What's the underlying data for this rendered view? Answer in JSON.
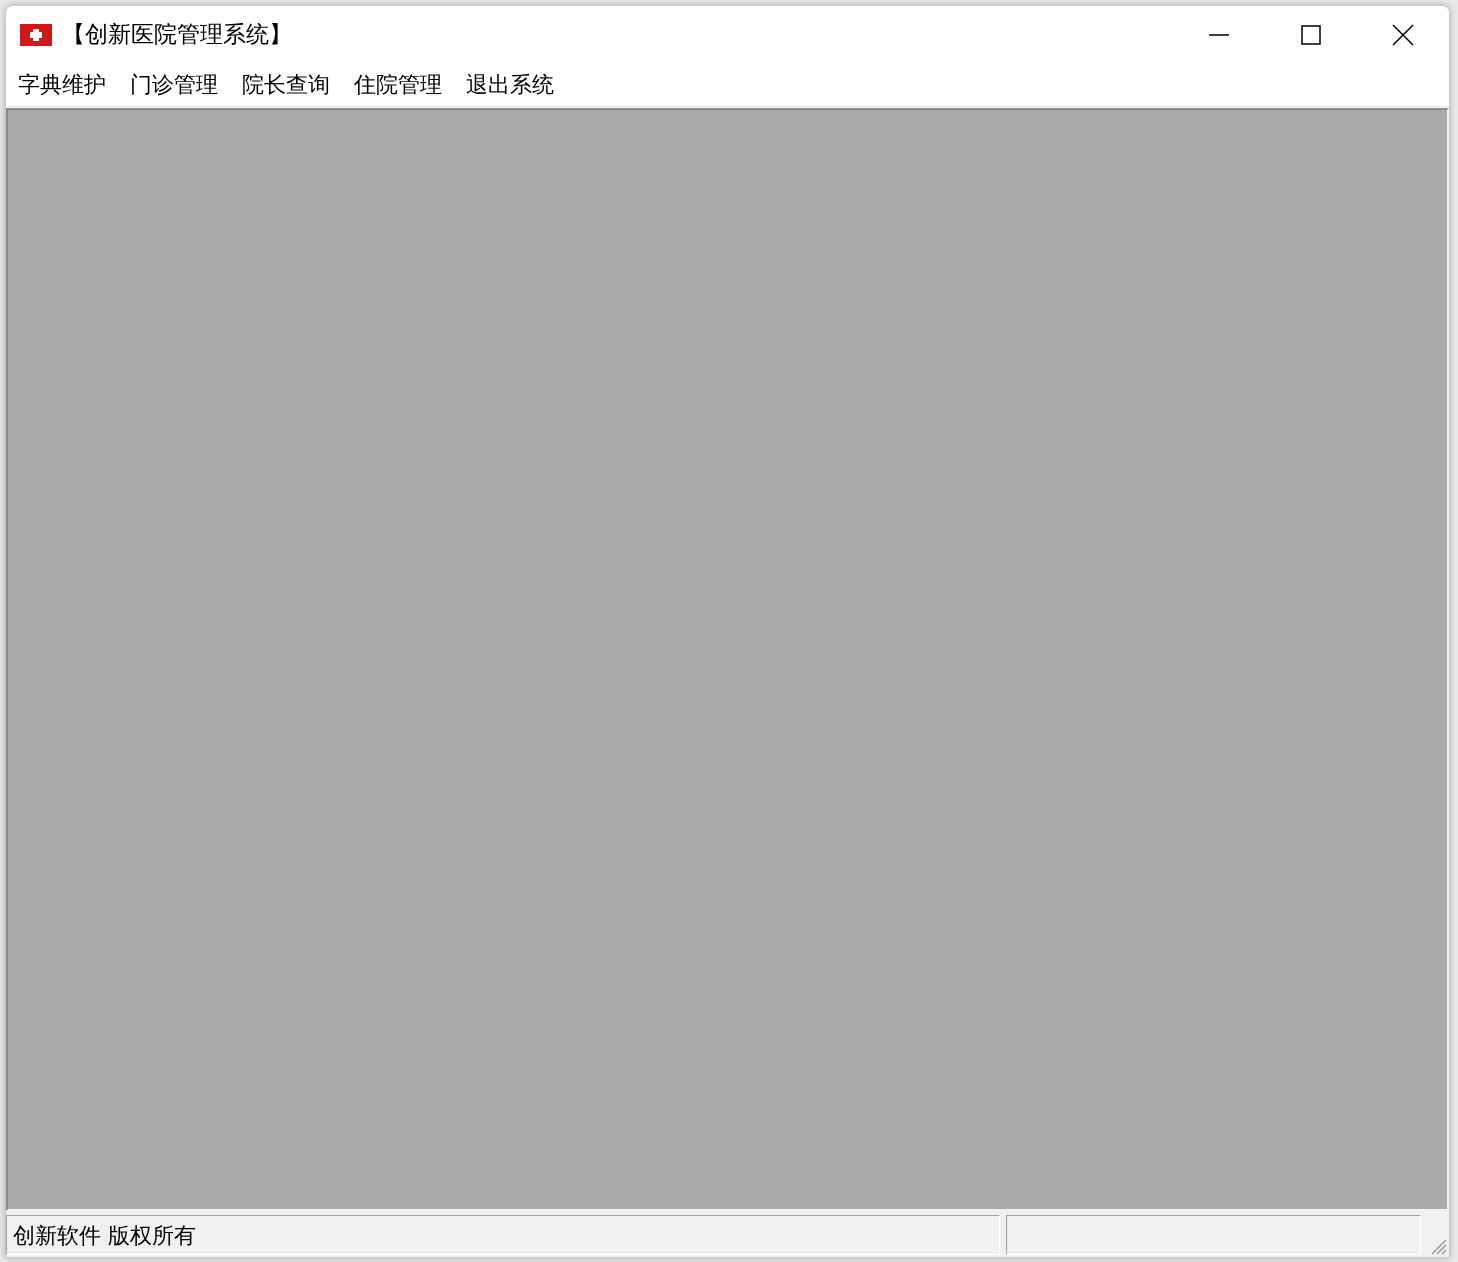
{
  "window": {
    "title": "【创新医院管理系统】"
  },
  "menu": [
    {
      "label": "字典维护"
    },
    {
      "label": "门诊管理"
    },
    {
      "label": "院长查询"
    },
    {
      "label": "住院管理"
    },
    {
      "label": "退出系统"
    }
  ],
  "status_bar": {
    "text": "创新软件 版权所有"
  }
}
